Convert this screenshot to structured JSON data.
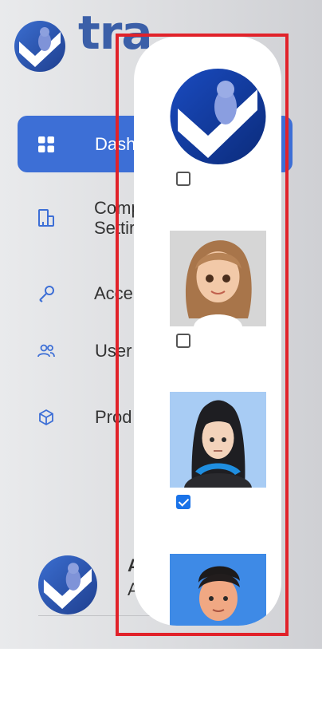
{
  "brand": {
    "name": "tra"
  },
  "nav": {
    "items": [
      {
        "label": "Dash",
        "icon": "grid-icon",
        "active": true
      },
      {
        "label": "Comp\nSettir",
        "icon": "building-icon"
      },
      {
        "label": "Acce",
        "icon": "key-icon"
      },
      {
        "label": "User",
        "icon": "users-icon"
      },
      {
        "label": "Prod",
        "icon": "cube-icon"
      }
    ]
  },
  "user": {
    "name": "A",
    "role": "A"
  },
  "avatar_picker": {
    "options": [
      {
        "name": "logo-avatar",
        "checked": false
      },
      {
        "name": "girl-avatar",
        "checked": false
      },
      {
        "name": "hoodie-avatar",
        "checked": true
      },
      {
        "name": "boy-avatar",
        "checked": false
      }
    ]
  },
  "colors": {
    "accent": "#3d6fd6",
    "brand_text": "#3b5fa8",
    "highlight": "#e1222a",
    "checkbox_checked": "#1a73e8"
  }
}
